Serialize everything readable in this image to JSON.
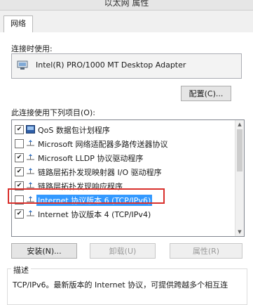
{
  "window": {
    "title": "以太网 属性"
  },
  "tabs": [
    {
      "label": "网络",
      "active": true
    }
  ],
  "connect_using": {
    "label": "连接时使用:",
    "adapter_name": "Intel(R) PRO/1000 MT Desktop Adapter",
    "icon": "network-adapter-icon"
  },
  "buttons": {
    "configure": "配置(C)...",
    "install": "安装(N)...",
    "uninstall": "卸载(U)",
    "properties": "属性(R)"
  },
  "items_label": "此连接使用下列项目(O):",
  "items": [
    {
      "label": "QoS 数据包计划程序",
      "checked": true,
      "icon": "qos-icon"
    },
    {
      "label": "Microsoft 网络适配器多路传送器协议",
      "checked": false,
      "icon": "protocol-icon"
    },
    {
      "label": "Microsoft LLDP 协议驱动程序",
      "checked": true,
      "icon": "protocol-icon"
    },
    {
      "label": "链路层拓扑发现映射器 I/O 驱动程序",
      "checked": true,
      "icon": "protocol-icon"
    },
    {
      "label": "链路层拓扑发现响应程序",
      "checked": true,
      "icon": "protocol-icon"
    },
    {
      "label": "Internet 协议版本 6 (TCP/IPv6)",
      "checked": false,
      "selected": true,
      "icon": "protocol-icon"
    },
    {
      "label": "Internet 协议版本 4 (TCP/IPv4)",
      "checked": true,
      "icon": "protocol-icon"
    }
  ],
  "description": {
    "label": "描述",
    "text": "TCP/IPv6。最新版本的 Internet 协议，可提供跨越多个相互连"
  },
  "colors": {
    "selection": "#3399ff",
    "highlight_border": "#d9302c"
  }
}
